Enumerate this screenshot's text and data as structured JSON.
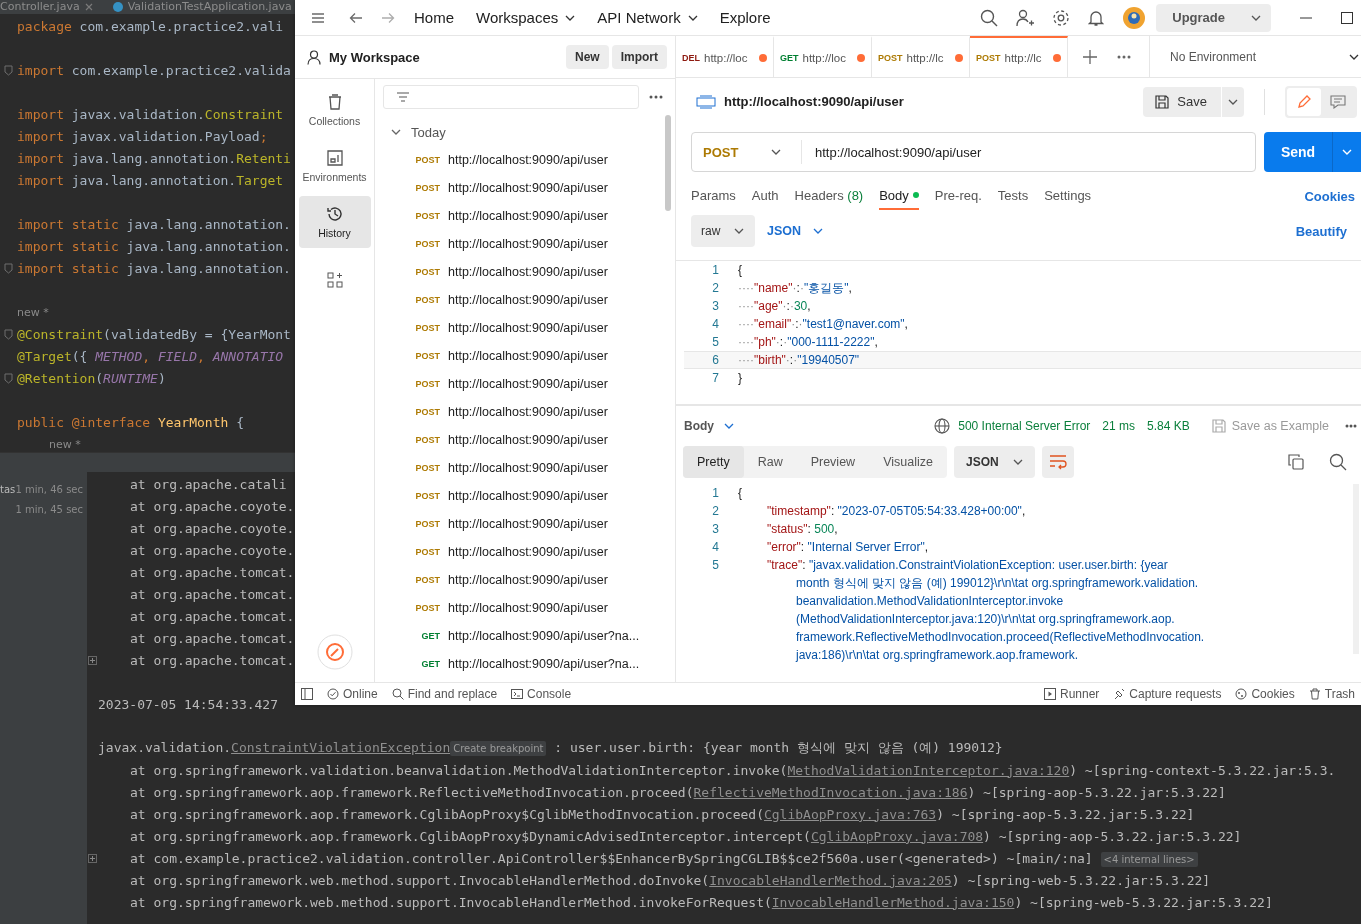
{
  "ide": {
    "editor_tabs": [
      {
        "label": "Controller.java",
        "kind": "file"
      },
      {
        "label": "ValidationTestApplication.java",
        "kind": "class"
      }
    ],
    "code_lines": [
      {
        "kind": "code",
        "fold": false,
        "tokens": [
          {
            "kind": "kw",
            "t": "package"
          },
          {
            "kind": "plain",
            "t": " com.example.practice2.vali"
          }
        ]
      },
      {
        "kind": "blank"
      },
      {
        "kind": "code",
        "fold": true,
        "tokens": [
          {
            "kind": "kw",
            "t": "import"
          },
          {
            "kind": "plain",
            "t": " com.example.practice2.valida"
          }
        ]
      },
      {
        "kind": "blank"
      },
      {
        "kind": "code",
        "fold": false,
        "tokens": [
          {
            "kind": "kw",
            "t": "import"
          },
          {
            "kind": "plain",
            "t": " javax.validation."
          },
          {
            "kind": "ann",
            "t": "Constraint"
          }
        ]
      },
      {
        "kind": "code",
        "fold": false,
        "tokens": [
          {
            "kind": "kw",
            "t": "import"
          },
          {
            "kind": "plain",
            "t": " javax.validation.Payload"
          },
          {
            "kind": "kw",
            "t": ";"
          }
        ]
      },
      {
        "kind": "code",
        "fold": false,
        "tokens": [
          {
            "kind": "kw",
            "t": "import"
          },
          {
            "kind": "plain",
            "t": " java.lang.annotation."
          },
          {
            "kind": "ann",
            "t": "Retenti"
          }
        ]
      },
      {
        "kind": "code",
        "fold": false,
        "tokens": [
          {
            "kind": "kw",
            "t": "import"
          },
          {
            "kind": "plain",
            "t": " java.lang.annotation."
          },
          {
            "kind": "ann",
            "t": "Target"
          }
        ]
      },
      {
        "kind": "blank"
      },
      {
        "kind": "code",
        "fold": false,
        "tokens": [
          {
            "kind": "kw",
            "t": "import static"
          },
          {
            "kind": "plain",
            "t": " java.lang.annotation."
          }
        ]
      },
      {
        "kind": "code",
        "fold": false,
        "tokens": [
          {
            "kind": "kw",
            "t": "import static"
          },
          {
            "kind": "plain",
            "t": " java.lang.annotation."
          }
        ]
      },
      {
        "kind": "code",
        "fold": true,
        "tokens": [
          {
            "kind": "kw",
            "t": "import static"
          },
          {
            "kind": "plain",
            "t": " java.lang.annotation."
          }
        ]
      },
      {
        "kind": "blank"
      },
      {
        "kind": "hint",
        "indented": false,
        "text": "new *"
      },
      {
        "kind": "code",
        "fold": true,
        "tokens": [
          {
            "kind": "ann",
            "t": "@Constraint"
          },
          {
            "kind": "plain",
            "t": "(validatedBy = {YearMont"
          }
        ]
      },
      {
        "kind": "code",
        "fold": false,
        "tokens": [
          {
            "kind": "ann",
            "t": "@Target"
          },
          {
            "kind": "plain",
            "t": "({ "
          },
          {
            "kind": "const",
            "t": "METHOD"
          },
          {
            "kind": "kw",
            "t": ", "
          },
          {
            "kind": "const",
            "t": "FIELD"
          },
          {
            "kind": "kw",
            "t": ", "
          },
          {
            "kind": "const",
            "t": "ANNOTATIO"
          }
        ]
      },
      {
        "kind": "code",
        "fold": true,
        "tokens": [
          {
            "kind": "ann",
            "t": "@Retention"
          },
          {
            "kind": "plain",
            "t": "("
          },
          {
            "kind": "const",
            "t": "RUNTIME"
          },
          {
            "kind": "plain",
            "t": ")"
          }
        ]
      },
      {
        "kind": "blank"
      },
      {
        "kind": "code",
        "fold": false,
        "tokens": [
          {
            "kind": "kw",
            "t": "public @interface "
          },
          {
            "kind": "type",
            "t": "YearMonth"
          },
          {
            "kind": "plain",
            "t": " {"
          }
        ]
      },
      {
        "kind": "hint",
        "indented": true,
        "text": "new *"
      }
    ],
    "run_items": [
      {
        "name": "tas",
        "time": "1 min, 46 sec"
      },
      {
        "time": "1 min, 45 sec"
      }
    ],
    "console_lines": [
      {
        "kind": "frame",
        "expand": false,
        "tokens": [
          {
            "kind": "plain",
            "t": "at org.apache.catali"
          }
        ]
      },
      {
        "kind": "frame",
        "expand": false,
        "tokens": [
          {
            "kind": "plain",
            "t": "at org.apache.coyote."
          }
        ]
      },
      {
        "kind": "frame",
        "expand": false,
        "tokens": [
          {
            "kind": "plain",
            "t": "at org.apache.coyote."
          }
        ]
      },
      {
        "kind": "frame",
        "expand": false,
        "tokens": [
          {
            "kind": "plain",
            "t": "at org.apache.coyote."
          }
        ]
      },
      {
        "kind": "frame",
        "expand": false,
        "tokens": [
          {
            "kind": "plain",
            "t": "at org.apache.tomcat."
          }
        ]
      },
      {
        "kind": "frame",
        "expand": false,
        "tokens": [
          {
            "kind": "plain",
            "t": "at org.apache.tomcat."
          }
        ]
      },
      {
        "kind": "frame",
        "expand": false,
        "tokens": [
          {
            "kind": "plain",
            "t": "at org.apache.tomcat."
          }
        ]
      },
      {
        "kind": "frame",
        "expand": false,
        "tokens": [
          {
            "kind": "plain",
            "t": "at org.apache.tomcat."
          }
        ]
      },
      {
        "kind": "frame",
        "expand": true,
        "tokens": [
          {
            "kind": "plain",
            "t": "at org.apache.tomcat."
          }
        ]
      },
      {
        "kind": "blank"
      },
      {
        "kind": "message",
        "expand": false,
        "tokens": [
          {
            "kind": "plain",
            "t": "2023-07-05 14:54:33.427"
          }
        ]
      },
      {
        "kind": "blank"
      },
      {
        "kind": "message",
        "expand": false,
        "tokens": [
          {
            "kind": "plain",
            "t": "javax.validation."
          },
          {
            "kind": "link",
            "t": "ConstraintViolationException"
          },
          {
            "kind": "badge",
            "t": "Create breakpoint"
          },
          {
            "kind": "plain",
            "t": " : user.user.birth: {year month 형식에 맞지 않음 (예) 199012}"
          }
        ]
      },
      {
        "kind": "frame",
        "expand": false,
        "tokens": [
          {
            "kind": "plain",
            "t": "at org.springframework.validation.beanvalidation.MethodValidationInterceptor.invoke("
          },
          {
            "kind": "link",
            "t": "MethodValidationInterceptor.java:120"
          },
          {
            "kind": "plain",
            "t": ") ~[spring-context-5.3.22.jar:5.3."
          }
        ]
      },
      {
        "kind": "frame",
        "expand": false,
        "tokens": [
          {
            "kind": "plain",
            "t": "at org.springframework.aop.framework.ReflectiveMethodInvocation.proceed("
          },
          {
            "kind": "link",
            "t": "ReflectiveMethodInvocation.java:186"
          },
          {
            "kind": "plain",
            "t": ") ~[spring-aop-5.3.22.jar:5.3.22]"
          }
        ]
      },
      {
        "kind": "frame",
        "expand": false,
        "tokens": [
          {
            "kind": "plain",
            "t": "at org.springframework.aop.framework.CglibAopProxy$CglibMethodInvocation.proceed("
          },
          {
            "kind": "link",
            "t": "CglibAopProxy.java:763"
          },
          {
            "kind": "plain",
            "t": ") ~[spring-aop-5.3.22.jar:5.3.22]"
          }
        ]
      },
      {
        "kind": "frame",
        "expand": false,
        "tokens": [
          {
            "kind": "plain",
            "t": "at org.springframework.aop.framework.CglibAopProxy$DynamicAdvisedInterceptor.intercept("
          },
          {
            "kind": "link",
            "t": "CglibAopProxy.java:708"
          },
          {
            "kind": "plain",
            "t": ") ~[spring-aop-5.3.22.jar:5.3.22]"
          }
        ]
      },
      {
        "kind": "frame",
        "expand": true,
        "tokens": [
          {
            "kind": "plain",
            "t": "at com.example.practice2.validation.controller.ApiController$$EnhancerBySpringCGLIB$$ce2f560a.user(<generated>) ~[main/:na] "
          },
          {
            "kind": "badge",
            "t": "<4 internal lines>"
          }
        ]
      },
      {
        "kind": "frame",
        "expand": false,
        "tokens": [
          {
            "kind": "plain",
            "t": "at org.springframework.web.method.support.InvocableHandlerMethod.doInvoke("
          },
          {
            "kind": "link",
            "t": "InvocableHandlerMethod.java:205"
          },
          {
            "kind": "plain",
            "t": ") ~[spring-web-5.3.22.jar:5.3.22]"
          }
        ]
      },
      {
        "kind": "frame",
        "expand": false,
        "tokens": [
          {
            "kind": "plain",
            "t": "at org.springframework.web.method.support.InvocableHandlerMethod.invokeForRequest("
          },
          {
            "kind": "link",
            "t": "InvocableHandlerMethod.java:150"
          },
          {
            "kind": "plain",
            "t": ") ~[spring-web-5.3.22.jar:5.3.22]"
          }
        ]
      }
    ]
  },
  "postman": {
    "nav": [
      {
        "label": "Home",
        "dropdown": false
      },
      {
        "label": "Workspaces",
        "dropdown": true
      },
      {
        "label": "API Network",
        "dropdown": true
      },
      {
        "label": "Explore",
        "dropdown": false
      }
    ],
    "upgrade": "Upgrade",
    "workspace": {
      "title": "My Workspace",
      "buttons": [
        "New",
        "Import"
      ]
    },
    "rail": [
      {
        "label": "Collections",
        "kind": "collections",
        "selected": false
      },
      {
        "label": "Environments",
        "kind": "environments",
        "selected": false
      },
      {
        "label": "History",
        "kind": "history",
        "selected": true
      }
    ],
    "history": {
      "group": "Today",
      "expanded": true,
      "items": [
        {
          "method": "POST",
          "color": "#ad7a03",
          "url": "http://localhost:9090/api/user"
        },
        {
          "method": "POST",
          "color": "#ad7a03",
          "url": "http://localhost:9090/api/user"
        },
        {
          "method": "POST",
          "color": "#ad7a03",
          "url": "http://localhost:9090/api/user"
        },
        {
          "method": "POST",
          "color": "#ad7a03",
          "url": "http://localhost:9090/api/user"
        },
        {
          "method": "POST",
          "color": "#ad7a03",
          "url": "http://localhost:9090/api/user"
        },
        {
          "method": "POST",
          "color": "#ad7a03",
          "url": "http://localhost:9090/api/user"
        },
        {
          "method": "POST",
          "color": "#ad7a03",
          "url": "http://localhost:9090/api/user"
        },
        {
          "method": "POST",
          "color": "#ad7a03",
          "url": "http://localhost:9090/api/user"
        },
        {
          "method": "POST",
          "color": "#ad7a03",
          "url": "http://localhost:9090/api/user"
        },
        {
          "method": "POST",
          "color": "#ad7a03",
          "url": "http://localhost:9090/api/user"
        },
        {
          "method": "POST",
          "color": "#ad7a03",
          "url": "http://localhost:9090/api/user"
        },
        {
          "method": "POST",
          "color": "#ad7a03",
          "url": "http://localhost:9090/api/user"
        },
        {
          "method": "POST",
          "color": "#ad7a03",
          "url": "http://localhost:9090/api/user"
        },
        {
          "method": "POST",
          "color": "#ad7a03",
          "url": "http://localhost:9090/api/user"
        },
        {
          "method": "POST",
          "color": "#ad7a03",
          "url": "http://localhost:9090/api/user"
        },
        {
          "method": "POST",
          "color": "#ad7a03",
          "url": "http://localhost:9090/api/user"
        },
        {
          "method": "POST",
          "color": "#ad7a03",
          "url": "http://localhost:9090/api/user"
        },
        {
          "method": "GET",
          "color": "#007f31",
          "url": "http://localhost:9090/api/user?na..."
        },
        {
          "method": "GET",
          "color": "#007f31",
          "url": "http://localhost:9090/api/user?na..."
        }
      ]
    },
    "tabs": [
      {
        "method": "DEL",
        "color": "#8e1a10",
        "label": "http://loc",
        "unsaved": true,
        "selected": false
      },
      {
        "method": "GET",
        "color": "#007f31",
        "label": "http://loc",
        "unsaved": true,
        "selected": false
      },
      {
        "method": "POST",
        "color": "#ad7a03",
        "label": "http://lc",
        "unsaved": true,
        "selected": false
      },
      {
        "method": "POST",
        "color": "#ad7a03",
        "label": "http://lc",
        "unsaved": true,
        "selected": true
      }
    ],
    "environment": "No Environment",
    "request": {
      "title": "http://localhost:9090/api/user",
      "save": "Save",
      "method": "POST",
      "url": "http://localhost:9090/api/user",
      "send": "Send",
      "tabs": [
        {
          "label": "Params",
          "selected": false,
          "indicator": false
        },
        {
          "label": "Auth",
          "selected": false,
          "indicator": false
        },
        {
          "label": "Headers",
          "count": "(8)",
          "selected": false,
          "indicator": false
        },
        {
          "label": "Body",
          "selected": true,
          "indicator": true
        },
        {
          "label": "Pre-req.",
          "selected": false,
          "indicator": false
        },
        {
          "label": "Tests",
          "selected": false,
          "indicator": false
        },
        {
          "label": "Settings",
          "selected": false,
          "indicator": false
        }
      ],
      "cookies": "Cookies",
      "body_mode": "raw",
      "body_lang": "JSON",
      "beautify": "Beautify",
      "body_lines": [
        {
          "num": "1",
          "current": false,
          "tokens": [
            {
              "kind": "p",
              "t": "{"
            }
          ]
        },
        {
          "num": "2",
          "current": false,
          "tokens": [
            {
              "kind": "ws",
              "t": "····"
            },
            {
              "kind": "key",
              "t": "\"name\""
            },
            {
              "kind": "ws",
              "t": "·"
            },
            {
              "kind": "p",
              "t": ":"
            },
            {
              "kind": "ws",
              "t": "·"
            },
            {
              "kind": "str",
              "t": "\"홍길동\""
            },
            {
              "kind": "p",
              "t": ","
            }
          ]
        },
        {
          "num": "3",
          "current": false,
          "tokens": [
            {
              "kind": "ws",
              "t": "····"
            },
            {
              "kind": "key",
              "t": "\"age\""
            },
            {
              "kind": "ws",
              "t": "·"
            },
            {
              "kind": "p",
              "t": ":"
            },
            {
              "kind": "ws",
              "t": "·"
            },
            {
              "kind": "num",
              "t": "30"
            },
            {
              "kind": "p",
              "t": ","
            }
          ]
        },
        {
          "num": "4",
          "current": false,
          "tokens": [
            {
              "kind": "ws",
              "t": "····"
            },
            {
              "kind": "key",
              "t": "\"email\""
            },
            {
              "kind": "ws",
              "t": "·"
            },
            {
              "kind": "p",
              "t": ":"
            },
            {
              "kind": "ws",
              "t": "·"
            },
            {
              "kind": "str",
              "t": "\"test1@naver.com\""
            },
            {
              "kind": "p",
              "t": ","
            }
          ]
        },
        {
          "num": "5",
          "current": false,
          "tokens": [
            {
              "kind": "ws",
              "t": "····"
            },
            {
              "kind": "key",
              "t": "\"ph\""
            },
            {
              "kind": "ws",
              "t": "·"
            },
            {
              "kind": "p",
              "t": ":"
            },
            {
              "kind": "ws",
              "t": "·"
            },
            {
              "kind": "str",
              "t": "\"000-1111-2222\""
            },
            {
              "kind": "p",
              "t": ","
            }
          ]
        },
        {
          "num": "6",
          "current": true,
          "tokens": [
            {
              "kind": "ws",
              "t": "····"
            },
            {
              "kind": "key",
              "t": "\"birth\""
            },
            {
              "kind": "ws",
              "t": "·"
            },
            {
              "kind": "p",
              "t": ":"
            },
            {
              "kind": "ws",
              "t": "·"
            },
            {
              "kind": "str",
              "t": "\"19940507\""
            }
          ]
        },
        {
          "num": "7",
          "current": false,
          "tokens": [
            {
              "kind": "p",
              "t": "}"
            }
          ]
        }
      ]
    },
    "response": {
      "section": "Body",
      "status": "500 Internal Server Error",
      "time": "21 ms",
      "size": "5.84 KB",
      "save_example": "Save as Example",
      "views": [
        {
          "label": "Pretty",
          "selected": true
        },
        {
          "label": "Raw",
          "selected": false
        },
        {
          "label": "Preview",
          "selected": false
        },
        {
          "label": "Visualize",
          "selected": false
        }
      ],
      "format": "JSON",
      "lines": [
        {
          "num": "1",
          "indented": false,
          "tokens": [
            {
              "kind": "p",
              "t": "{"
            }
          ]
        },
        {
          "num": "2",
          "indented": true,
          "tokens": [
            {
              "kind": "key",
              "t": "\"timestamp\""
            },
            {
              "kind": "p",
              "t": ": "
            },
            {
              "kind": "str",
              "t": "\"2023-07-05T05:54:33.428+00:00\""
            },
            {
              "kind": "p",
              "t": ","
            }
          ]
        },
        {
          "num": "3",
          "indented": true,
          "tokens": [
            {
              "kind": "key",
              "t": "\"status\""
            },
            {
              "kind": "p",
              "t": ": "
            },
            {
              "kind": "num",
              "t": "500"
            },
            {
              "kind": "p",
              "t": ","
            }
          ]
        },
        {
          "num": "4",
          "indented": true,
          "tokens": [
            {
              "kind": "key",
              "t": "\"error\""
            },
            {
              "kind": "p",
              "t": ": "
            },
            {
              "kind": "str",
              "t": "\"Internal Server Error\""
            },
            {
              "kind": "p",
              "t": ","
            }
          ]
        },
        {
          "num": "5",
          "indented": true,
          "tokens": [
            {
              "kind": "key",
              "t": "\"trace\""
            },
            {
              "kind": "p",
              "t": ": "
            },
            {
              "kind": "str",
              "t": "\"javax.validation.ConstraintViolationException: user.user.birth: {year"
            }
          ],
          "wrapped": [
            "month 형식에 맞지 않음 (예) 199012}\\r\\n\\tat org.springframework.validation.",
            "beanvalidation.MethodValidationInterceptor.invoke",
            "(MethodValidationInterceptor.java:120)\\r\\n\\tat org.springframework.aop.",
            "framework.ReflectiveMethodInvocation.proceed(ReflectiveMethodInvocation.",
            "java:186)\\r\\n\\tat org.springframework.aop.framework."
          ]
        }
      ]
    },
    "status_bar": {
      "left": [
        {
          "label": "Online",
          "kind": "online"
        },
        {
          "label": "Find and replace",
          "kind": "search"
        },
        {
          "label": "Console",
          "kind": "console"
        }
      ],
      "right": [
        {
          "label": "Runner",
          "kind": "runner"
        },
        {
          "label": "Capture requests",
          "kind": "capture"
        },
        {
          "label": "Cookies",
          "kind": "cookies"
        },
        {
          "label": "Trash",
          "kind": "trash"
        }
      ]
    }
  }
}
